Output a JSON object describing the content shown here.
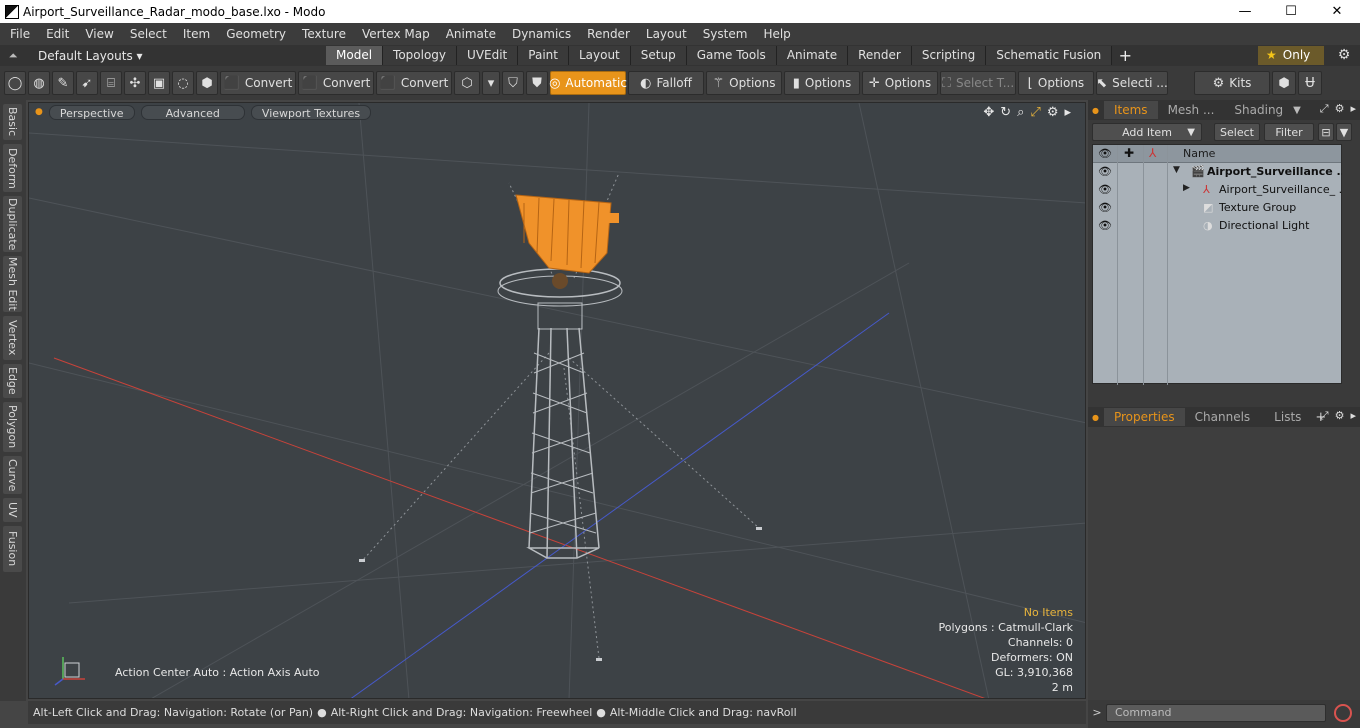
{
  "window": {
    "title": "Airport_Surveillance_Radar_modo_base.lxo - Modo",
    "minimize": "—",
    "maximize": "☐",
    "close": "✕"
  },
  "menu": [
    "File",
    "Edit",
    "View",
    "Select",
    "Item",
    "Geometry",
    "Texture",
    "Vertex Map",
    "Animate",
    "Dynamics",
    "Render",
    "Layout",
    "System",
    "Help"
  ],
  "layout_bar": {
    "dropdown": "Default Layouts ▾",
    "tabs": [
      "Model",
      "Topology",
      "UVEdit",
      "Paint",
      "Layout",
      "Setup",
      "Game Tools",
      "Animate",
      "Render",
      "Scripting",
      "Schematic Fusion"
    ],
    "active_tab": "Model",
    "plus": "+",
    "only": "Only",
    "gear_icon": "gear-icon"
  },
  "toolbar": {
    "convert1": "Convert",
    "convert2": "Convert",
    "convert3": "Convert",
    "automatic": "Automatic",
    "falloff": "Falloff",
    "options1": "Options",
    "options2": "Options",
    "options3": "Options",
    "select_t": "Select T...",
    "options4": "Options",
    "selecti": "Selecti ...",
    "kits": "Kits"
  },
  "left_tabs": [
    "Basic",
    "Deform",
    "Duplicate",
    "Mesh Edit",
    "Vertex",
    "Edge",
    "Polygon",
    "Curve",
    "UV",
    "Fusion"
  ],
  "viewport": {
    "buttons": [
      "Perspective",
      "Advanced",
      "Viewport Textures"
    ],
    "stats": {
      "no_items": "No Items",
      "polygons": "Polygons : Catmull-Clark",
      "channels": "Channels: 0",
      "deformers": "Deformers: ON",
      "gl": "GL: 3,910,368",
      "scale": "2 m"
    },
    "action_center": "Action Center Auto : Action Axis Auto",
    "radar_color": "#f0922a",
    "grid_color": "#4e5358",
    "x_axis_color": "#c8433a",
    "z_axis_color": "#4659c9"
  },
  "status_bar": {
    "hint1": "Alt-Left Click and Drag: Navigation: Rotate (or Pan)",
    "hint2": "Alt-Right Click and Drag: Navigation: Freewheel",
    "hint3": "Alt-Middle Click and Drag: navRoll"
  },
  "items_panel": {
    "tabs": [
      "Items",
      "Mesh ...",
      "Shading"
    ],
    "active_tab": "Items",
    "add_item": "Add Item",
    "select": "Select",
    "filter": "Filter",
    "column_name": "Name",
    "rows": [
      {
        "label": "Airport_Surveillance ...",
        "icon": "scene-icon",
        "bold": true
      },
      {
        "label": "Airport_Surveillance_ ...",
        "icon": "mesh-locator-icon",
        "bold": false
      },
      {
        "label": "Texture Group",
        "icon": "texture-group-icon",
        "bold": false
      },
      {
        "label": "Directional Light",
        "icon": "light-icon",
        "bold": false
      }
    ]
  },
  "properties_panel": {
    "tabs": [
      "Properties",
      "Channels",
      "Lists"
    ],
    "active_tab": "Properties",
    "plus": "+"
  },
  "command_bar": {
    "placeholder": "Command",
    "chevron": ">"
  }
}
